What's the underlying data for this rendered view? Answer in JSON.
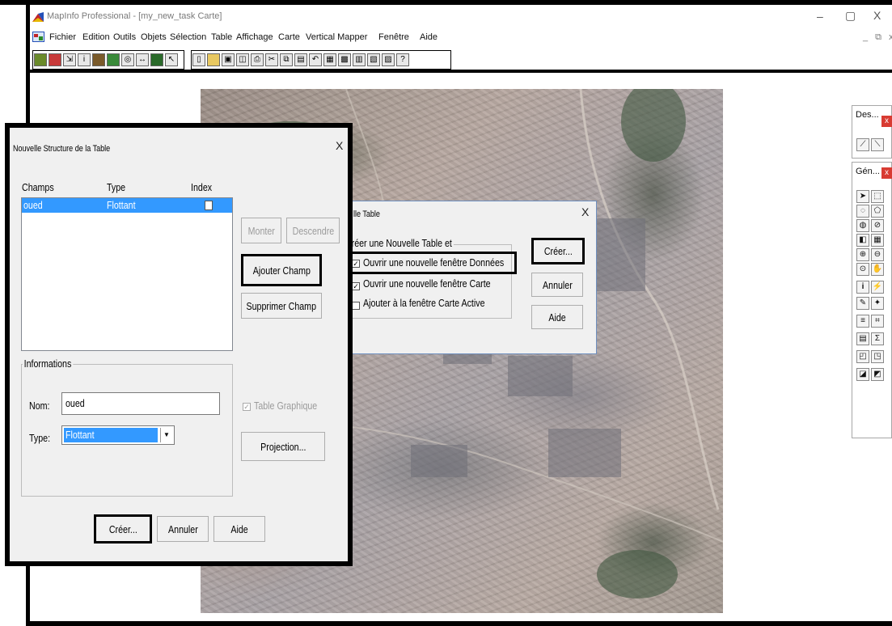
{
  "window": {
    "title": "MapInfo Professional - [my_new_task Carte]",
    "controls": {
      "minimize": "–",
      "maximize": "▢",
      "close": "X"
    },
    "mdi_controls": "_ ⧉ x"
  },
  "menubar": {
    "items": [
      "Fichier",
      "Edition",
      "Outils",
      "Objets",
      "Sélection",
      "Table",
      "Affichage",
      "Carte",
      "Vertical Mapper",
      "Fenêtre",
      "Aide"
    ]
  },
  "toolbar": {
    "icons": [
      "layer-control-icon",
      "map-style-icon",
      "select-icon",
      "info-icon",
      "layout-icon",
      "legend-icon",
      "statistics-icon",
      "ruler-icon",
      "hotlink-icon",
      "pointer-icon",
      "new-icon",
      "open-icon",
      "save-icon",
      "page-setup-icon",
      "print-icon",
      "cut-icon",
      "copy-icon",
      "paste-icon",
      "undo-icon",
      "new-browser-icon",
      "new-map-icon",
      "new-graph-icon",
      "new-layout-icon",
      "redistrict-icon",
      "help-icon"
    ]
  },
  "panels": {
    "drawing": {
      "title": "Des...",
      "close": "x"
    },
    "general": {
      "title": "Gén...",
      "close": "x"
    }
  },
  "dialog_structure": {
    "title": "Nouvelle Structure de la Table",
    "close": "X",
    "headers": {
      "fields": "Champs",
      "type": "Type",
      "index": "Index"
    },
    "rows": [
      {
        "field": "oued",
        "type": "Flottant"
      }
    ],
    "buttons": {
      "up": "Monter",
      "down": "Descendre",
      "add_field": "Ajouter Champ",
      "delete_field": "Supprimer Champ",
      "projection": "Projection...",
      "create": "Créer...",
      "cancel": "Annuler",
      "help": "Aide"
    },
    "info_group": "Informations",
    "name_label": "Nom:",
    "name_value": "oued",
    "type_label": "Type:",
    "type_value": "Flottant",
    "table_graphic_label": "Table Graphique"
  },
  "dialog_new_table": {
    "title": "lle Table",
    "close": "X",
    "group_label": "réer une Nouvelle Table et",
    "options": [
      {
        "label": "Ouvrir une nouvelle fenêtre Données",
        "checked": true
      },
      {
        "label": "Ouvrir une nouvelle fenêtre Carte",
        "checked": true
      },
      {
        "label": "Ajouter à la fenêtre Carte Active",
        "checked": false
      }
    ],
    "buttons": {
      "create": "Créer...",
      "cancel": "Annuler",
      "help": "Aide"
    }
  },
  "colors": {
    "selection": "#3399ff",
    "dialog_bg": "#f0f0f0",
    "highlight_border": "#000000",
    "close_red": "#d83b32"
  }
}
